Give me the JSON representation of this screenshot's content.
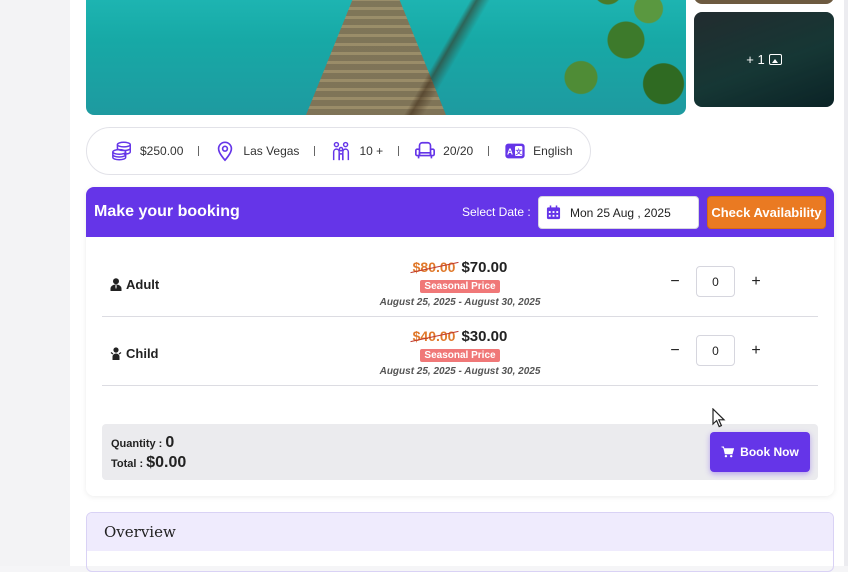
{
  "gallery": {
    "more_label": "+ 1"
  },
  "facts": [
    {
      "icon": "coins-icon",
      "text": "$250.00"
    },
    {
      "icon": "location-pin-icon",
      "text": "Las Vegas"
    },
    {
      "icon": "group-icon",
      "text": "10 +"
    },
    {
      "icon": "seat-icon",
      "text": "20/20"
    },
    {
      "icon": "language-icon",
      "text": "English"
    }
  ],
  "booking": {
    "title": "Make your booking",
    "select_date_label": "Select Date :",
    "date_value": "Mon 25 Aug , 2025",
    "check_availability_label": "Check Availability",
    "tickets": [
      {
        "name": "Adult",
        "icon": "adult-icon",
        "old_price": "$80.00",
        "new_price": "$70.00",
        "badge": "Seasonal Price",
        "date_range": "August 25, 2025 - August 30, 2025",
        "quantity": "0",
        "minus": "−",
        "plus": "+"
      },
      {
        "name": "Child",
        "icon": "child-icon",
        "old_price": "$40.00",
        "new_price": "$30.00",
        "badge": "Seasonal Price",
        "date_range": "August 25, 2025 - August 30, 2025",
        "quantity": "0",
        "minus": "−",
        "plus": "+"
      }
    ],
    "summary": {
      "quantity_label": "Quantity :",
      "quantity_value": "0",
      "total_label": "Total :",
      "total_value": "$0.00"
    },
    "book_now_label": "Book Now"
  },
  "overview": {
    "title": "Overview"
  },
  "colors": {
    "primary": "#6535e8",
    "accent": "#ea7a22",
    "badge": "#f07878"
  }
}
